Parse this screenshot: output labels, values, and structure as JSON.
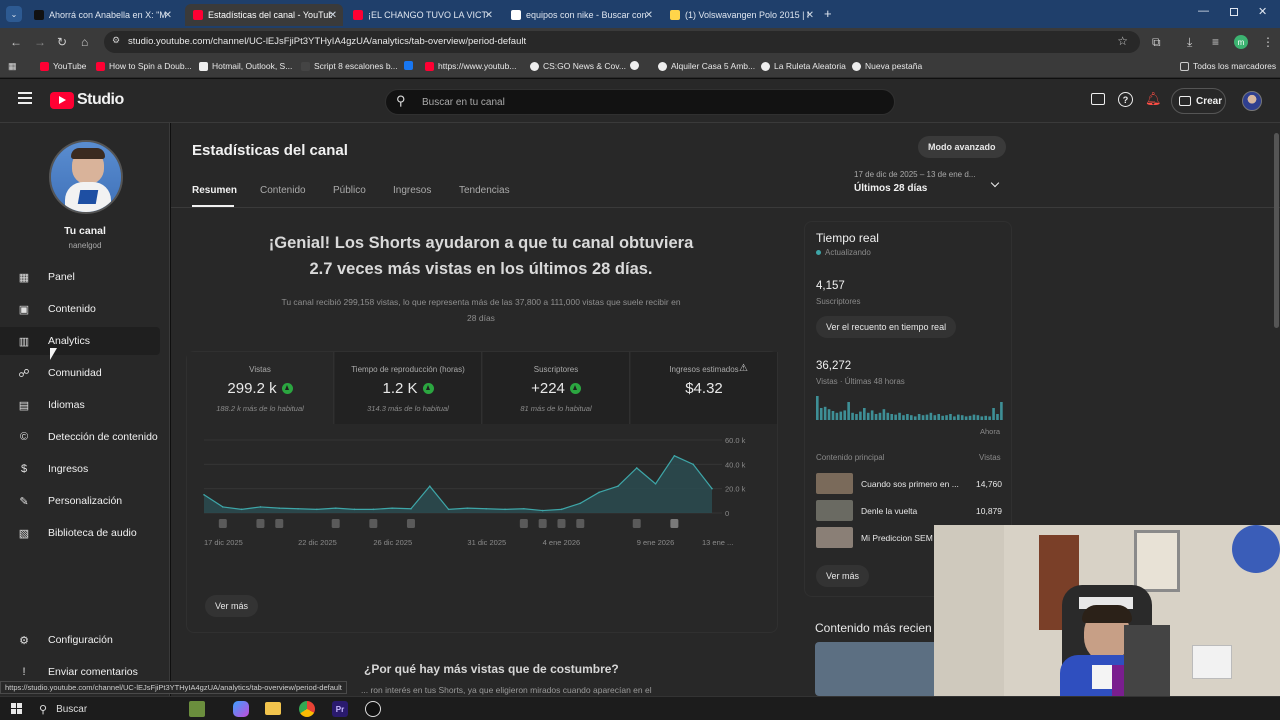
{
  "browser": {
    "tabs": [
      {
        "label": "Ahorrá con Anabella en X: \"Ma",
        "fav": "#111111"
      },
      {
        "label": "Estadísticas del canal - YouTube",
        "fav": "#ff0033"
      },
      {
        "label": "¡EL CHANGO TUVO LA VICTORI",
        "fav": "#ff0033"
      },
      {
        "label": "equipos con nike - Buscar con G",
        "fav": "#ffffff"
      },
      {
        "label": "(1) Volswavangen Polo 2015 | M",
        "fav": "#ffd54a"
      }
    ],
    "new_tab": "+",
    "url": "studio.youtube.com/channel/UC-lEJsFjiPt3YTHyIA4gzUA/analytics/tab-overview/period-default",
    "bookmarks": [
      "YouTube",
      "How to Spin a Doub...",
      "Hotmail, Outlook, S...",
      "Script 8 escalones b...",
      "",
      "https://www.youtub...",
      "CS:GO News & Cov...",
      "",
      "Alquiler Casa 5 Amb...",
      "La Ruleta Aleatoria",
      "Nueva pestaña"
    ],
    "all_bookmarks": "Todos los marcadores",
    "status_url": "https://studio.youtube.com/channel/UC-lEJsFjiPt3YTHyIA4gzUA/analytics/tab-overview/period-default",
    "profile_initial": "m"
  },
  "header": {
    "logo": "Studio",
    "search_placeholder": "Buscar en tu canal",
    "create_label": "Crear"
  },
  "sidebar": {
    "channel_title": "Tu canal",
    "channel_handle": "nanelgod",
    "items": [
      {
        "label": "Panel",
        "icon": "dashboard-icon"
      },
      {
        "label": "Contenido",
        "icon": "content-icon"
      },
      {
        "label": "Analytics",
        "icon": "analytics-icon"
      },
      {
        "label": "Comunidad",
        "icon": "community-icon"
      },
      {
        "label": "Idiomas",
        "icon": "subtitles-icon"
      },
      {
        "label": "Detección de contenido",
        "icon": "copyright-icon"
      },
      {
        "label": "Ingresos",
        "icon": "earn-icon"
      },
      {
        "label": "Personalización",
        "icon": "customization-icon"
      },
      {
        "label": "Biblioteca de audio",
        "icon": "audio-library-icon"
      }
    ],
    "settings": "Configuración",
    "feedback": "Enviar comentarios"
  },
  "page": {
    "title": "Estadísticas del canal",
    "advanced_mode": "Modo avanzado",
    "tabs": [
      "Resumen",
      "Contenido",
      "Público",
      "Ingresos",
      "Tendencias"
    ],
    "date_range": "17 de dic de 2025 – 13 de ene d...",
    "date_period": "Últimos 28 días"
  },
  "summary": {
    "headline_1": "¡Genial! Los Shorts ayudaron a que tu canal obtuviera",
    "headline_2": "2.7 veces más vistas en los últimos 28 días.",
    "subtext_1": "Tu canal recibió 299,158 vistas, lo que representa más de las 37,800 a 111,000 vistas que suele recibir en",
    "subtext_2": "28 días",
    "metrics": [
      {
        "label": "Vistas",
        "value": "299.2 k",
        "sub": "188.2 k más de lo habitual",
        "up": true
      },
      {
        "label": "Tiempo de reproducción (horas)",
        "value": "1.2 K",
        "sub": "314.3 más de lo habitual",
        "up": true
      },
      {
        "label": "Suscriptores",
        "value": "+224",
        "sub": "81 más de lo habitual",
        "up": true
      },
      {
        "label": "Ingresos estimados",
        "value": "$4.32",
        "sub": "",
        "up": false
      }
    ],
    "see_more": "Ver más",
    "why_more": "¿Por qué hay más vistas que de costumbre?",
    "why_text": "... ron interés en tus Shorts, ya que eligieron mirados cuando aparecían en el"
  },
  "chart_data": {
    "type": "area",
    "x": [
      "17 dic 2025",
      "18",
      "19",
      "20",
      "21",
      "22 dic 2025",
      "23",
      "24",
      "25",
      "26 dic 2025",
      "27",
      "28",
      "29",
      "30",
      "31 dic 2025",
      "1",
      "2",
      "3",
      "4 ene 2026",
      "5",
      "6",
      "7",
      "8",
      "9 ene 2026",
      "10",
      "11",
      "12",
      "13 ene ..."
    ],
    "x_tick_labels": [
      "17 dic 2025",
      "22 dic 2025",
      "26 dic 2025",
      "31 dic 2025",
      "4 ene 2026",
      "9 ene 2026",
      "13 ene ..."
    ],
    "y_tick_labels": [
      "60.0 k",
      "40.0 k",
      "20.0 k",
      "0"
    ],
    "ylim": [
      0,
      60000
    ],
    "series": [
      {
        "values": [
          15000,
          5000,
          3000,
          5000,
          4000,
          3500,
          3000,
          4000,
          3000,
          3000,
          4000,
          3500,
          22000,
          3000,
          4000,
          3500,
          3000,
          3500,
          2000,
          3000,
          8000,
          17000,
          22000,
          37000,
          24000,
          47000,
          40000,
          20000
        ]
      }
    ],
    "grid": true,
    "color": "#3ea6a8"
  },
  "realtime": {
    "title": "Tiempo real",
    "status": "Actualizando",
    "subs_value": "4,157",
    "subs_label": "Suscriptores",
    "realtime_button": "Ver el recuento en tiempo real",
    "views_value": "36,272",
    "views_label": "Vistas · Últimas 48 horas",
    "now_label": "Ahora",
    "bars": [
      40,
      20,
      22,
      18,
      15,
      12,
      14,
      16,
      30,
      12,
      10,
      14,
      20,
      12,
      16,
      10,
      12,
      18,
      12,
      10,
      9,
      12,
      8,
      10,
      8,
      6,
      10,
      8,
      9,
      12,
      8,
      10,
      7,
      8,
      10,
      6,
      9,
      8,
      6,
      7,
      9,
      8,
      6,
      7,
      6,
      20,
      10,
      30
    ],
    "top_content_label": "Contenido principal",
    "views_col_label": "Vistas",
    "top_content": [
      {
        "title": "Cuando sos primero en ...",
        "views": "14,760"
      },
      {
        "title": "Denle la vuelta",
        "views": "10,879"
      },
      {
        "title": "Mi Prediccion SEM",
        "views": ""
      }
    ],
    "see_more": "Ver más",
    "latest_content": "Contenido más recien"
  },
  "taskbar": {
    "search": "Buscar"
  }
}
